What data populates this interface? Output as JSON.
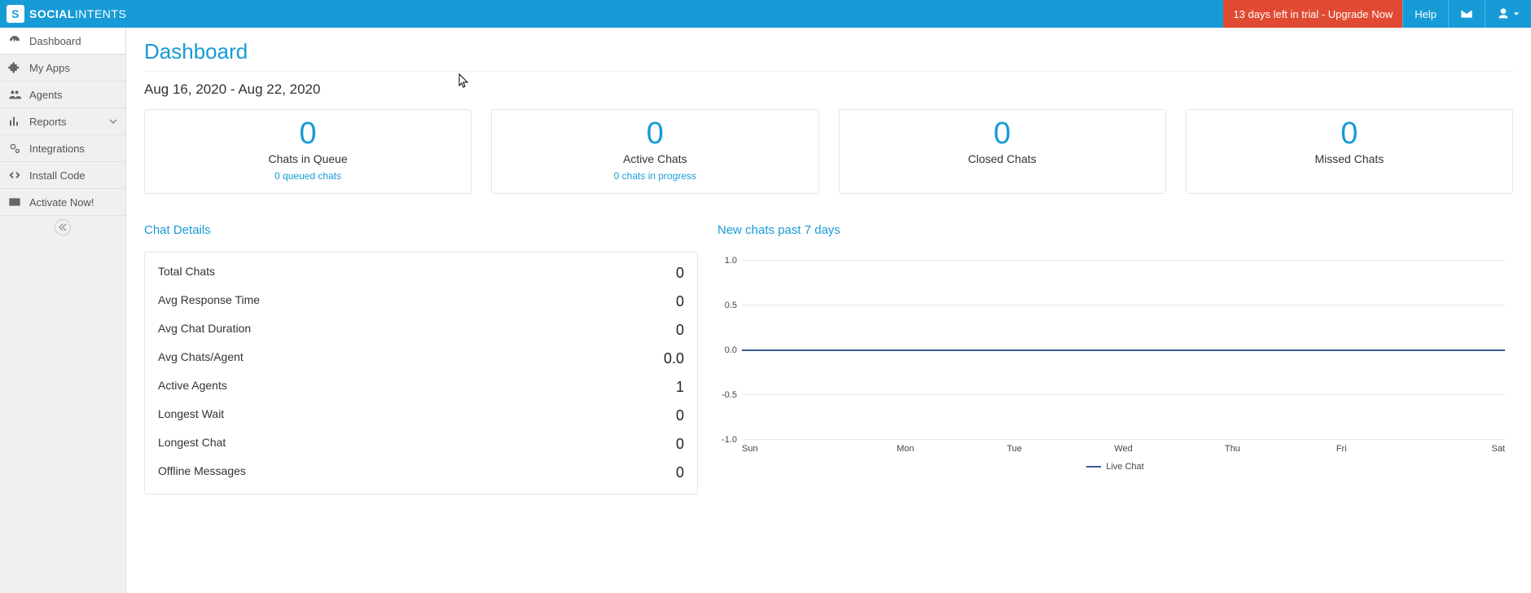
{
  "brand": {
    "first": "SOCIAL",
    "second": "INTENTS"
  },
  "topbar": {
    "trial_text": "13 days left in trial - Upgrade Now",
    "help_label": "Help"
  },
  "nav": [
    {
      "label": "Dashboard",
      "icon": "dashboard",
      "active": true
    },
    {
      "label": "My Apps",
      "icon": "puzzle"
    },
    {
      "label": "Agents",
      "icon": "users"
    },
    {
      "label": "Reports",
      "icon": "bar",
      "expandable": true
    },
    {
      "label": "Integrations",
      "icon": "cogs"
    },
    {
      "label": "Install Code",
      "icon": "code"
    },
    {
      "label": "Activate Now!",
      "icon": "card"
    }
  ],
  "page_title": "Dashboard",
  "date_range": "Aug 16, 2020 - Aug 22, 2020",
  "cards": [
    {
      "value": "0",
      "label": "Chats in Queue",
      "sub": "0 queued chats"
    },
    {
      "value": "0",
      "label": "Active Chats",
      "sub": "0 chats in progress"
    },
    {
      "value": "0",
      "label": "Closed Chats",
      "sub": null
    },
    {
      "value": "0",
      "label": "Missed Chats",
      "sub": null
    }
  ],
  "chat_details_title": "Chat Details",
  "chat_details": [
    {
      "label": "Total Chats",
      "value": "0"
    },
    {
      "label": "Avg Response Time",
      "value": "0"
    },
    {
      "label": "Avg Chat Duration",
      "value": "0"
    },
    {
      "label": "Avg Chats/Agent",
      "value": "0.0"
    },
    {
      "label": "Active Agents",
      "value": "1"
    },
    {
      "label": "Longest Wait",
      "value": "0"
    },
    {
      "label": "Longest Chat",
      "value": "0"
    },
    {
      "label": "Offline Messages",
      "value": "0"
    }
  ],
  "chart_title": "New chats past 7 days",
  "chart_data": {
    "type": "line",
    "title": "New chats past 7 days",
    "xlabel": "",
    "ylabel": "",
    "ylim": [
      -1.0,
      1.0
    ],
    "y_ticks": [
      "1.0",
      "0.5",
      "0.0",
      "-0.5",
      "-1.0"
    ],
    "categories": [
      "Sun",
      "Mon",
      "Tue",
      "Wed",
      "Thu",
      "Fri",
      "Sat"
    ],
    "series": [
      {
        "name": "Live Chat",
        "values": [
          0,
          0,
          0,
          0,
          0,
          0,
          0
        ]
      }
    ],
    "legend_position": "bottom",
    "grid": true
  }
}
